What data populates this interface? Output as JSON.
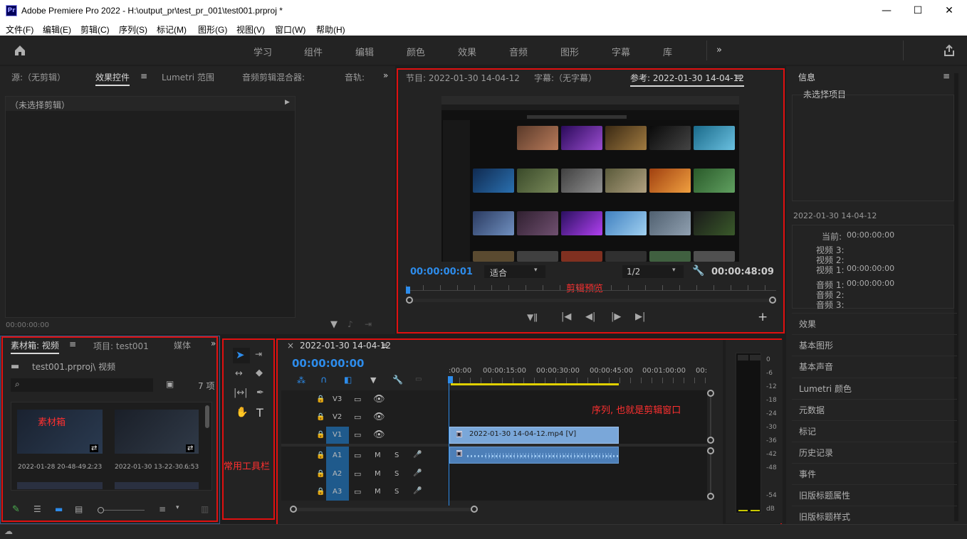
{
  "window": {
    "app_icon": "Pr",
    "title": "Adobe Premiere Pro 2022 - H:\\output_pr\\test_pr_001\\test001.prproj *",
    "controls": {
      "minimize": "—",
      "maximize": "☐",
      "close": "✕"
    }
  },
  "menu": [
    "文件(F)",
    "编辑(E)",
    "剪辑(C)",
    "序列(S)",
    "标记(M)",
    "图形(G)",
    "视图(V)",
    "窗口(W)",
    "帮助(H)"
  ],
  "workspaces": [
    "学习",
    "组件",
    "编辑",
    "颜色",
    "效果",
    "音频",
    "图形",
    "字幕",
    "库"
  ],
  "workspace_more": "»",
  "source_panel": {
    "tabs": [
      "源:（无剪辑）",
      "效果控件",
      "Lumetri 范围",
      "音频剪辑混合器:",
      "音轨:"
    ],
    "active_tab_menu": "≡",
    "more": "»",
    "no_clip": "（未选择剪辑）",
    "timecode": "00:00:00:00"
  },
  "program_panel": {
    "tabs": [
      "节目: 2022-01-30 14-04-12",
      "字幕:（无字幕）",
      "参考: 2022-01-30 14-04-12"
    ],
    "menu": "≡",
    "timecode_left": "00:00:00:01",
    "fit": "适合",
    "resolution": "1/2",
    "timecode_right": "00:00:48:09",
    "annotation": "剪辑预览",
    "add": "+"
  },
  "bins_panel": {
    "tabs": [
      "素材箱: 视频",
      "项目: test001",
      "媒体"
    ],
    "more": "»",
    "path": "test001.prproj\\ 视频",
    "count": "7 项",
    "annotation": "素材箱",
    "clips": [
      {
        "name": "2022-01-28 20-48-49...",
        "duration": "2:23"
      },
      {
        "name": "2022-01-30 13-22-30...",
        "duration": "6:53"
      }
    ]
  },
  "tools_panel": {
    "annotation": "常用工具栏",
    "text_tool": "T"
  },
  "timeline_panel": {
    "close": "×",
    "sequence": "2022-01-30 14-04-12",
    "menu": "≡",
    "timecode": "00:00:00:00",
    "ruler": [
      ":00:00",
      "00:00:15:00",
      "00:00:30:00",
      "00:00:45:00",
      "00:01:00:00",
      "00:"
    ],
    "annotation": "序列, 也就是剪辑窗口",
    "video_tracks": [
      "V3",
      "V2",
      "V1"
    ],
    "audio_tracks": [
      "A1",
      "A2",
      "A3"
    ],
    "mute": "M",
    "solo": "S",
    "clip_video": "2022-01-30 14-04-12.mp4 [V]"
  },
  "meters": {
    "labels": [
      "0",
      "-6",
      "-12",
      "-18",
      "-24",
      "-30",
      "-36",
      "-42",
      "-48",
      "-54",
      "dB"
    ]
  },
  "info_panel": {
    "title": "信息",
    "menu": "≡",
    "no_selection": "未选择项目",
    "sequence": "2022-01-30 14-04-12",
    "rows": [
      {
        "label": "当前:",
        "value": "00:00:00:00"
      },
      {
        "label": "视频 3:",
        "value": ""
      },
      {
        "label": "视频 2:",
        "value": ""
      },
      {
        "label": "视频 1:",
        "value": "00:00:00:00"
      },
      {
        "label": "音频 1:",
        "value": "00:00:00:00"
      },
      {
        "label": "音频 2:",
        "value": ""
      },
      {
        "label": "音频 3:",
        "value": ""
      }
    ],
    "panels": [
      "效果",
      "基本图形",
      "基本声音",
      "Lumetri 颜色",
      "元数据",
      "标记",
      "历史记录",
      "事件",
      "旧版标题属性",
      "旧版标题样式"
    ]
  },
  "colors": {
    "accent": "#2d8ceb",
    "annotation_red": "#e01010",
    "track_active": "#1f5a8c",
    "clip_video": "#7aa7d9",
    "clip_audio": "#4d7fb8"
  }
}
